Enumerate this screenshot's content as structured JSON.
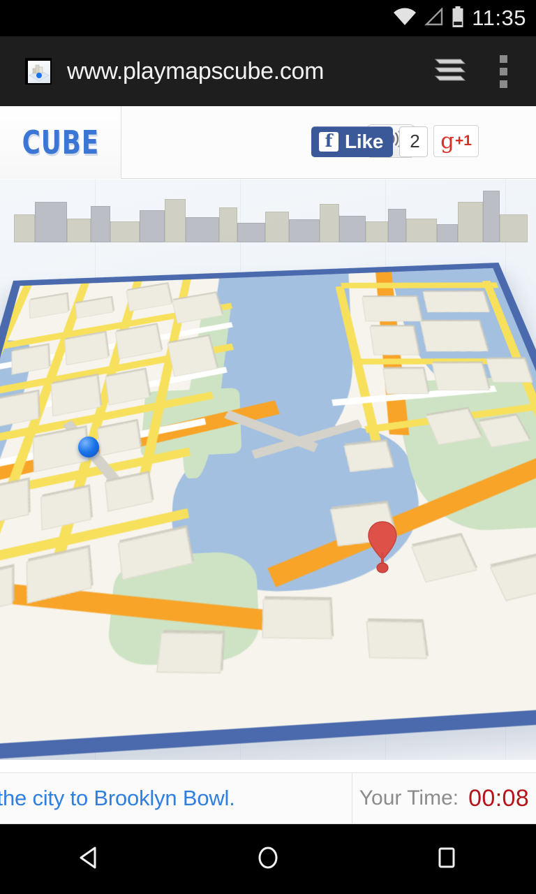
{
  "status_bar": {
    "clock": "11:35",
    "icons": [
      "wifi-icon",
      "cell-signal-icon",
      "battery-icon"
    ]
  },
  "browser": {
    "url": "www.playmapscube.com",
    "favicon_name": "site-favicon",
    "tab_stack_name": "tab-stack-icon",
    "menu_name": "overflow-menu-icon"
  },
  "site_header": {
    "logo": "CUBE",
    "sound_icon": "speaker-icon",
    "gplus": {
      "g": "g",
      "plus": "+1"
    },
    "facebook": {
      "f": "f",
      "like_label": "Like",
      "count": "2"
    }
  },
  "game": {
    "player_marker": "blue-ball",
    "destination_marker": "red-map-pin",
    "rotate_control": "rotate-left-arrow",
    "colors": {
      "map_border": "#4a6aad",
      "water": "#a3c0e0",
      "park": "#cde3c4",
      "road_minor": "#f7e05c",
      "road_major": "#f7a429",
      "player": "#1a73e8",
      "pin": "#db4437"
    }
  },
  "info_bar": {
    "mission_text": "ugh the city to Brooklyn Bowl.",
    "time_label": "Your Time:",
    "time_value": "00:08"
  },
  "nav_bar": {
    "back": "back-icon",
    "home": "home-icon",
    "recents": "recents-icon"
  }
}
